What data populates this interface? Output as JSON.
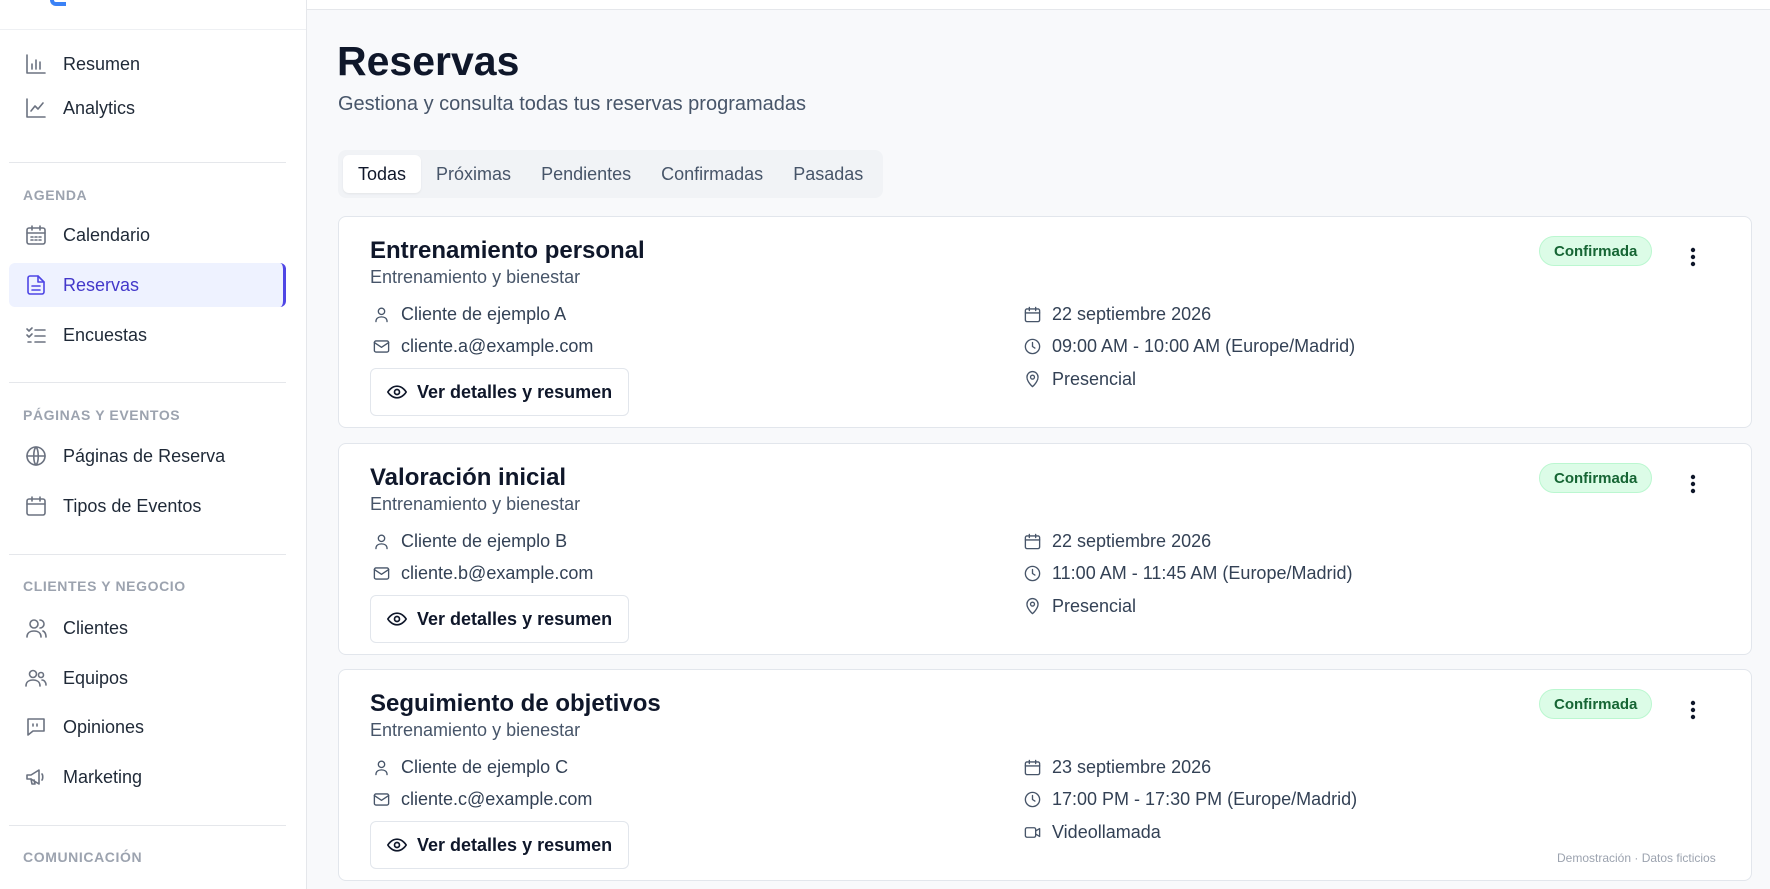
{
  "sidebar": {
    "sections": [
      {
        "label": ""
      },
      {
        "label": "AGENDA"
      },
      {
        "label": "PÁGINAS Y EVENTOS"
      },
      {
        "label": "CLIENTES Y NEGOCIO"
      },
      {
        "label": "COMUNICACIÓN"
      }
    ],
    "items": [
      {
        "label": "Resumen",
        "icon": "bar-chart-icon"
      },
      {
        "label": "Analytics",
        "icon": "line-chart-icon"
      },
      {
        "label": "Calendario",
        "icon": "calendar-grid-icon"
      },
      {
        "label": "Reservas",
        "icon": "document-icon",
        "active": true
      },
      {
        "label": "Encuestas",
        "icon": "checklist-icon"
      },
      {
        "label": "Páginas de Reserva",
        "icon": "globe-icon"
      },
      {
        "label": "Tipos de Eventos",
        "icon": "calendar-icon"
      },
      {
        "label": "Clientes",
        "icon": "users-icon"
      },
      {
        "label": "Equipos",
        "icon": "team-icon"
      },
      {
        "label": "Opiniones",
        "icon": "quote-icon"
      },
      {
        "label": "Marketing",
        "icon": "megaphone-icon"
      }
    ]
  },
  "page": {
    "title": "Reservas",
    "subtitle": "Gestiona y consulta todas tus reservas programadas"
  },
  "tabs": [
    {
      "label": "Todas",
      "active": true
    },
    {
      "label": "Próximas"
    },
    {
      "label": "Pendientes"
    },
    {
      "label": "Confirmadas"
    },
    {
      "label": "Pasadas"
    }
  ],
  "bookings": [
    {
      "title": "Entrenamiento personal",
      "category": "Entrenamiento y bienestar",
      "client": "Cliente de ejemplo A",
      "email": "cliente.a@example.com",
      "date": "22 septiembre 2026",
      "time": "09:00 AM - 10:00 AM (Europe/Madrid)",
      "location": "Presencial",
      "location_icon": "map-pin-icon",
      "status": "Confirmada",
      "button": "Ver detalles y resumen"
    },
    {
      "title": "Valoración inicial",
      "category": "Entrenamiento y bienestar",
      "client": "Cliente de ejemplo B",
      "email": "cliente.b@example.com",
      "date": "22 septiembre 2026",
      "time": "11:00 AM - 11:45 AM (Europe/Madrid)",
      "location": "Presencial",
      "location_icon": "map-pin-icon",
      "status": "Confirmada",
      "button": "Ver detalles y resumen"
    },
    {
      "title": "Seguimiento de objetivos",
      "category": "Entrenamiento y bienestar",
      "client": "Cliente de ejemplo C",
      "email": "cliente.c@example.com",
      "date": "23 septiembre 2026",
      "time": "17:00 PM - 17:30 PM (Europe/Madrid)",
      "location": "Videollamada",
      "location_icon": "video-icon",
      "status": "Confirmada",
      "button": "Ver detalles y resumen"
    }
  ],
  "footnote": "Demostración · Datos ficticios",
  "colors": {
    "accent": "#4f46e5",
    "active_bg": "#eef2ff",
    "status_bg": "#dcfce7",
    "status_text": "#166534"
  }
}
